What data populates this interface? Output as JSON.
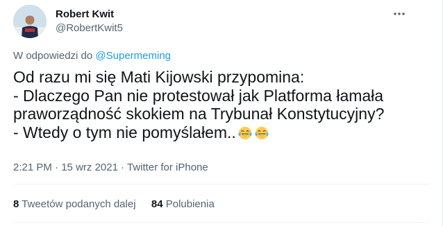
{
  "author": {
    "name": "Robert Kwit",
    "handle": "@RobertKwit5"
  },
  "reply": {
    "prefix": "W odpowiedzi do",
    "mention": "@Supermeming"
  },
  "body": {
    "line1": "Od razu mi się Mati Kijowski przypomina:",
    "line2": "- Dlaczego Pan nie protestował jak Platforma łamała",
    "line3": "praworządność skokiem na Trybunał Konstytucyjny?",
    "line4": "- Wtedy o tym nie pomyślałem..",
    "emojis": [
      "face-with-tears-of-joy",
      "face-with-tears-of-joy"
    ]
  },
  "meta": {
    "time": "2:21 PM",
    "date": "15 wrz 2021",
    "source": "Twitter for iPhone",
    "sep": "·"
  },
  "stats": {
    "retweets_count": "8",
    "retweets_label": "Tweetów podanych dalej",
    "likes_count": "84",
    "likes_label": "Polubienia"
  },
  "colors": {
    "text": "#0f1419",
    "secondary": "#536471",
    "link": "#1d9bf0",
    "divider": "#eff3f4"
  },
  "icons": {
    "more": "more-dots-icon"
  }
}
